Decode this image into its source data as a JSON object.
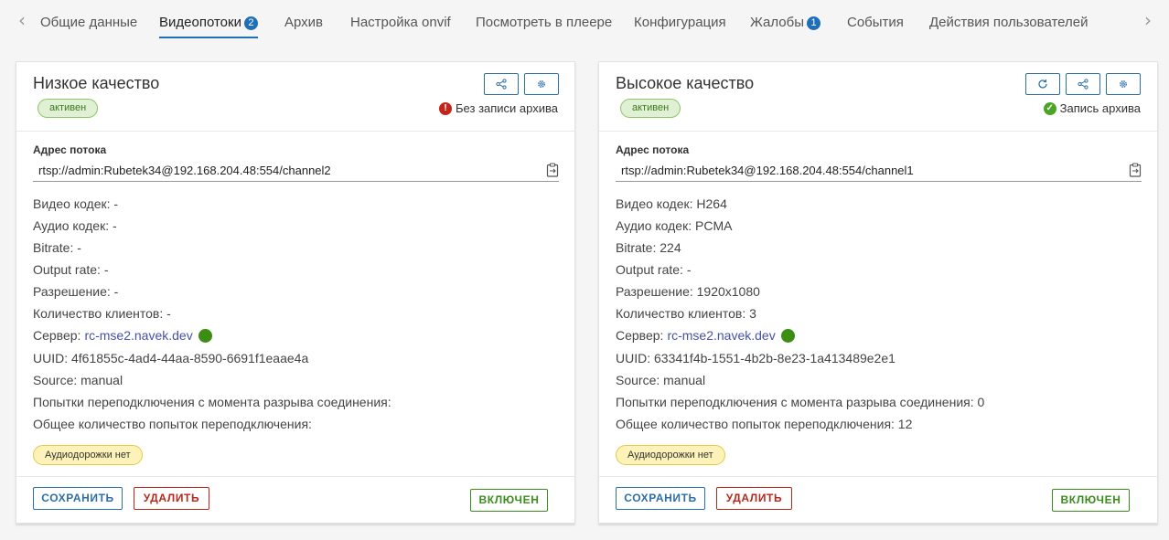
{
  "tabs": [
    {
      "label": "Общие данные",
      "badge": null
    },
    {
      "label": "Видеопотоки",
      "badge": "2",
      "active": true
    },
    {
      "label": "Архив",
      "badge": null
    },
    {
      "label": "Настройка onvif",
      "badge": null
    },
    {
      "label": "Посмотреть в плеере",
      "badge": null
    },
    {
      "label": "Конфигурация",
      "badge": null
    },
    {
      "label": "Жалобы",
      "badge": "1"
    },
    {
      "label": "События",
      "badge": null
    },
    {
      "label": "Действия пользователей",
      "badge": null
    }
  ],
  "streams": [
    {
      "title": "Низкое качество",
      "status": "активен",
      "archive": {
        "text": "Без записи архива",
        "state": "off",
        "color": "#c0261b"
      },
      "address_label": "Адрес потока",
      "address": "rtsp://admin:Rubetek34@192.168.204.48:554/channel2",
      "lines": [
        "Видео кодек: -",
        "Аудио кодек: -",
        "Bitrate: -",
        "Output rate: -",
        "Разрешение: -",
        "Количество клиентов: -"
      ],
      "server_label": "Сервер:",
      "server": "rc-mse2.navek.dev",
      "lines2": [
        "UUID: 4f61855c-4ad4-44aa-8590-6691f1eaae4a",
        "Source: manual",
        "Попытки переподключения с момента разрыва соединения:",
        "Общее количество попыток переподключения:"
      ],
      "audio": "Аудиодорожки нет",
      "save": "СОХРАНИТЬ",
      "delete": "УДАЛИТЬ",
      "enabled": "ВКЛЮЧЕН",
      "icons": [
        "share-icon",
        "gear-icon"
      ]
    },
    {
      "title": "Высокое качество",
      "status": "активен",
      "archive": {
        "text": "Запись архива",
        "state": "on",
        "color": "#4aa524"
      },
      "address_label": "Адрес потока",
      "address": "rtsp://admin:Rubetek34@192.168.204.48:554/channel1",
      "lines": [
        "Видео кодек: H264",
        "Аудио кодек: PCMA",
        "Bitrate: 224",
        "Output rate: -",
        "Разрешение: 1920x1080",
        "Количество клиентов: 3"
      ],
      "server_label": "Сервер:",
      "server": "rc-mse2.navek.dev",
      "lines2": [
        "UUID: 63341f4b-1551-4b2b-8e23-1a413489e2e1",
        "Source: manual",
        "Попытки переподключения с момента разрыва соединения: 0",
        "Общее количество попыток переподключения: 12"
      ],
      "audio": "Аудиодорожки нет",
      "save": "СОХРАНИТЬ",
      "delete": "УДАЛИТЬ",
      "enabled": "ВКЛЮЧЕН",
      "icons": [
        "refresh-icon",
        "share-icon",
        "gear-icon"
      ]
    }
  ],
  "colors": {
    "accent": "#1e6fb8",
    "danger": "#b8271b",
    "success": "#3d8a1e",
    "server_online": "#3b8d13"
  }
}
